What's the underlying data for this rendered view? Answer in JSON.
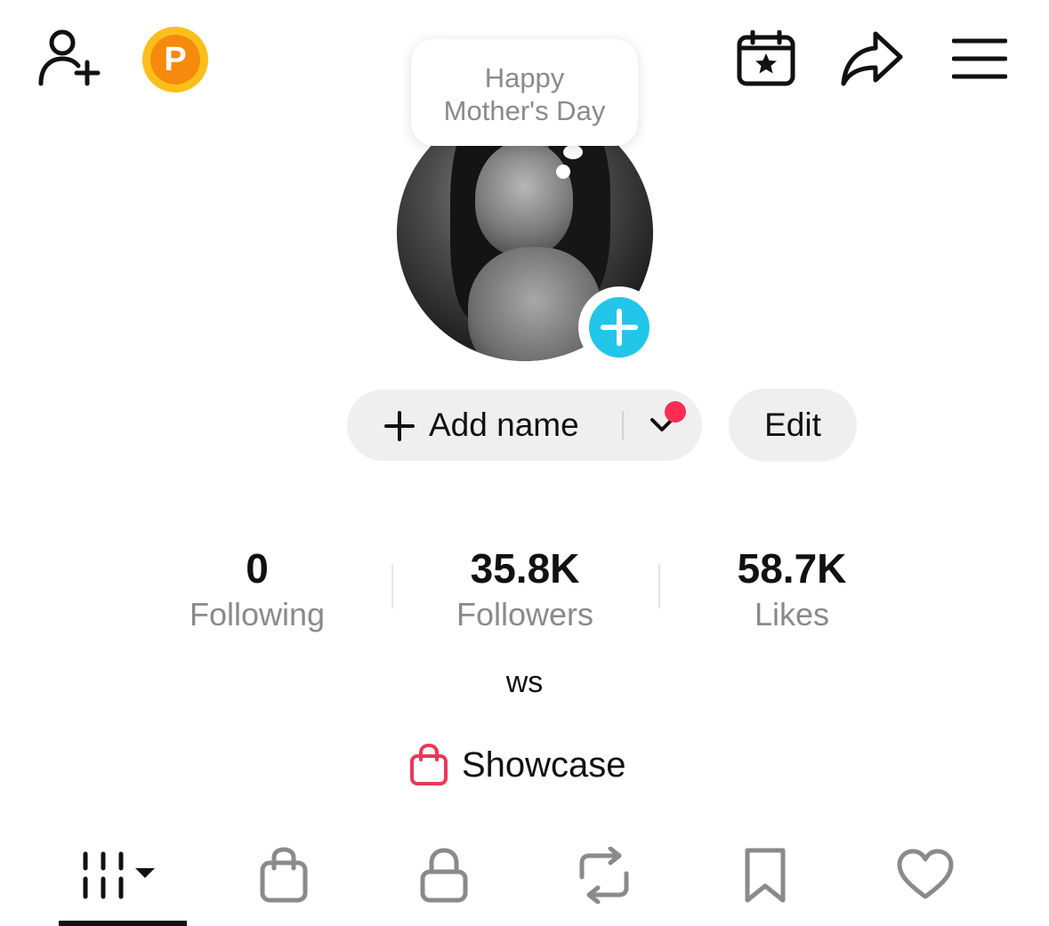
{
  "header": {
    "icons": [
      "add-friend-icon",
      "coin-icon",
      "calendar-star-icon",
      "share-icon",
      "menu-icon"
    ],
    "coin_letter": "P"
  },
  "bubble": {
    "line1": "Happy",
    "line2": "Mother's Day"
  },
  "profile": {
    "add_name_label": "Add name",
    "edit_label": "Edit",
    "bio": "ws"
  },
  "stats": [
    {
      "value": "0",
      "label": "Following"
    },
    {
      "value": "35.8K",
      "label": "Followers"
    },
    {
      "value": "58.7K",
      "label": "Likes"
    }
  ],
  "showcase": {
    "label": "Showcase",
    "icon": "shopping-bag-icon",
    "icon_color": "#e8395a"
  },
  "tabs": [
    {
      "icon": "grid-videos-icon",
      "active": true
    },
    {
      "icon": "shopping-bag-icon",
      "active": false
    },
    {
      "icon": "lock-icon",
      "active": false
    },
    {
      "icon": "repost-icon",
      "active": false
    },
    {
      "icon": "bookmark-icon",
      "active": false
    },
    {
      "icon": "heart-icon",
      "active": false
    }
  ],
  "colors": {
    "accent_blue": "#22c6e8",
    "notification_red": "#fe2c55",
    "coin_outer": "#fbbf1c",
    "coin_inner": "#f58a0d"
  }
}
